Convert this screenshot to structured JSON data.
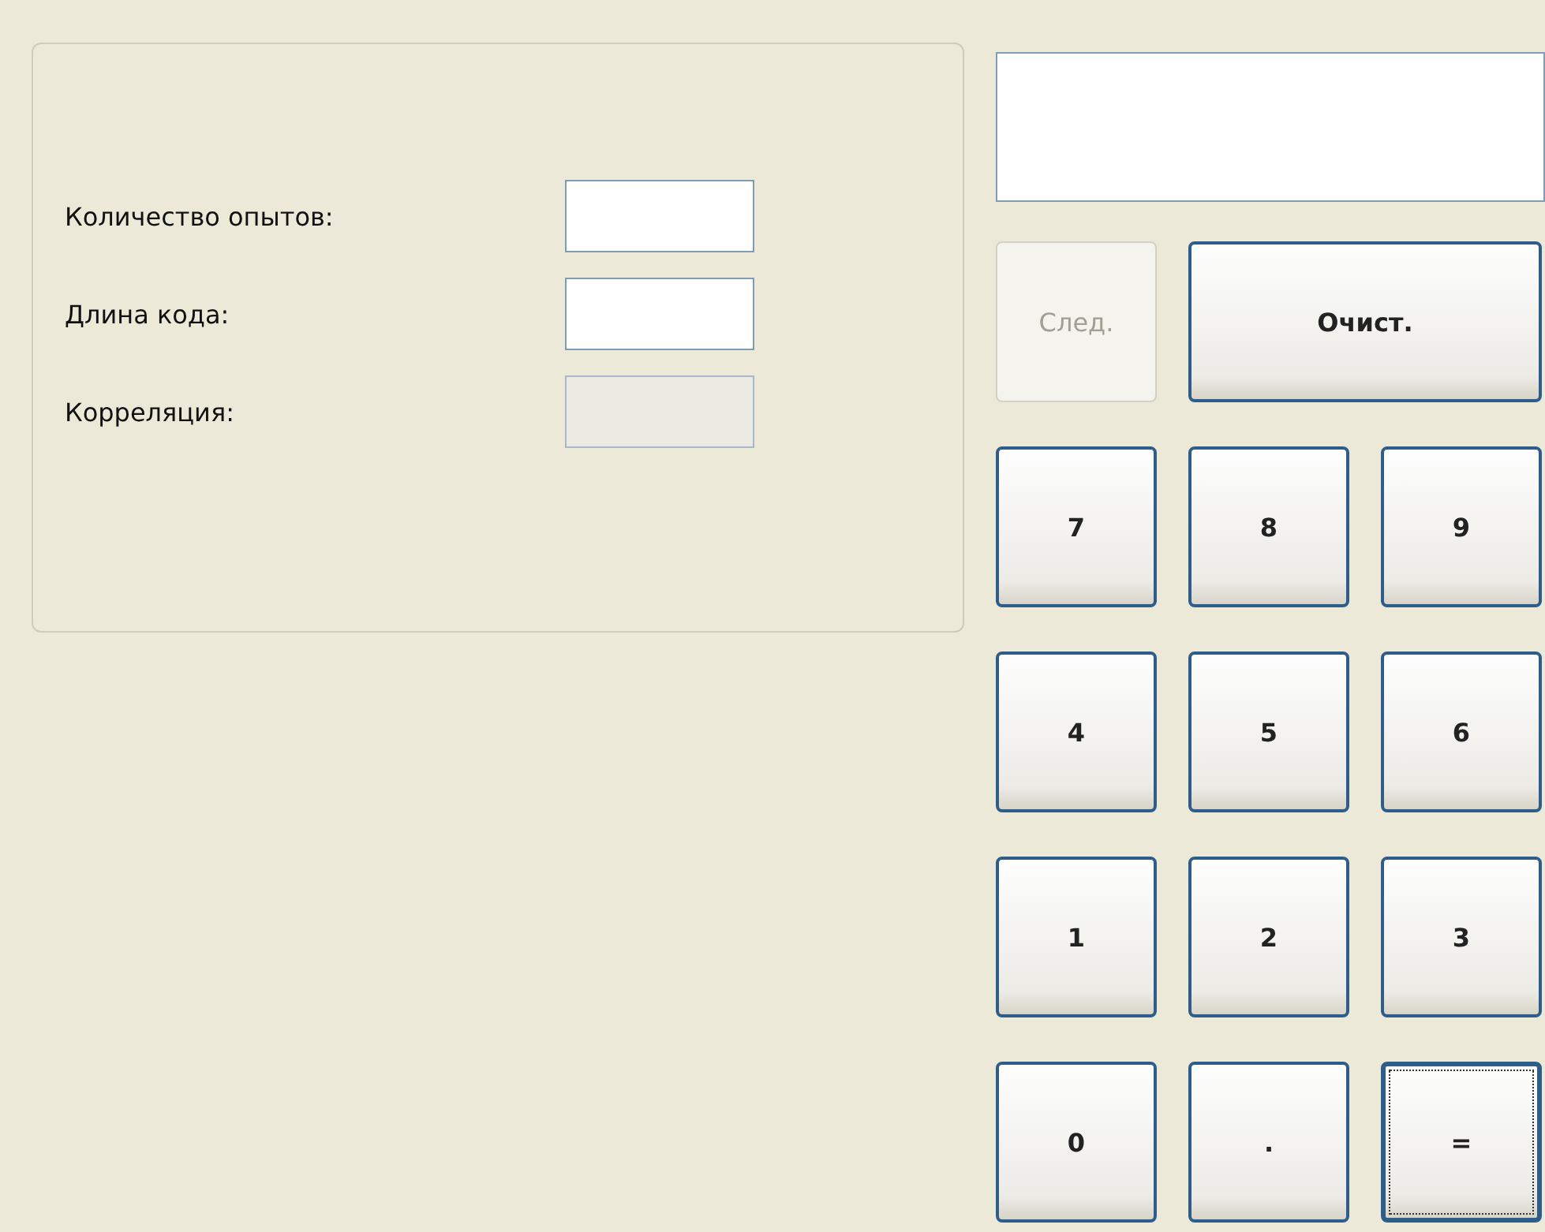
{
  "form": {
    "fields": [
      {
        "label": "Количество опытов:",
        "disabled": false
      },
      {
        "label": "Длина кода:",
        "disabled": false
      },
      {
        "label": "Корреляция:",
        "disabled": true
      }
    ]
  },
  "display": {
    "kind": "field"
  },
  "actions": [
    {
      "label": "След.",
      "disabled": true
    },
    {
      "label": "Очист.",
      "disabled": false
    }
  ],
  "keypad": [
    {
      "label": "7",
      "focused": false
    },
    {
      "label": "8",
      "focused": false
    },
    {
      "label": "9",
      "focused": false
    },
    {
      "label": "4",
      "focused": false
    },
    {
      "label": "5",
      "focused": false
    },
    {
      "label": "6",
      "focused": false
    },
    {
      "label": "1",
      "focused": false
    },
    {
      "label": "2",
      "focused": false
    },
    {
      "label": "3",
      "focused": false
    },
    {
      "label": "0",
      "focused": false
    },
    {
      "label": ".",
      "focused": false
    },
    {
      "label": "=",
      "focused": true
    }
  ]
}
